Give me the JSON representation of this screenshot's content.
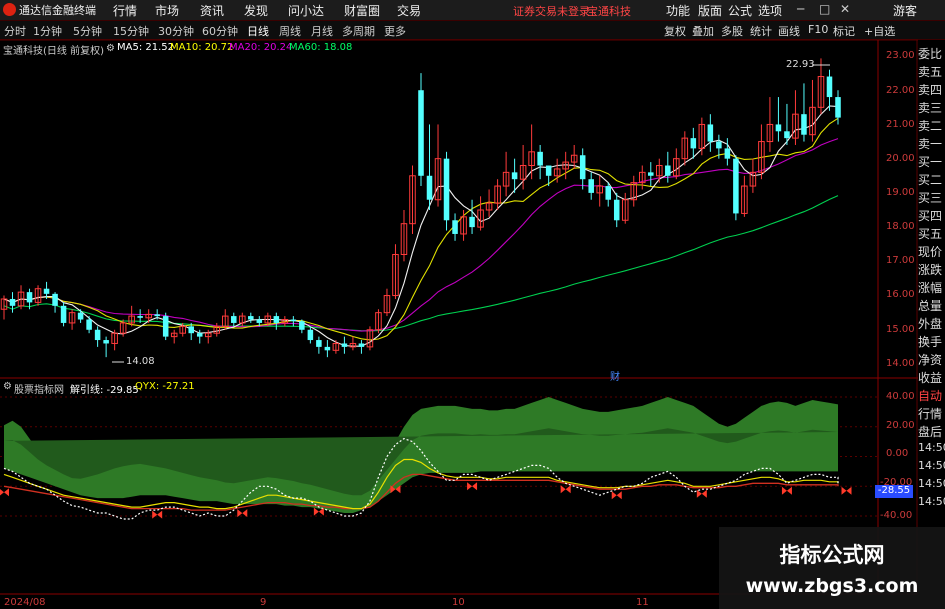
{
  "titlebar": {
    "app_name": "通达信金融终端",
    "menus": [
      "行情",
      "市场",
      "资讯",
      "发现",
      "问小达",
      "财富圈",
      "交易"
    ],
    "notice": "证券交易未登录",
    "stock_name": "宝通科技",
    "right_menus": [
      "功能",
      "版面",
      "公式",
      "选项"
    ],
    "user": "游客"
  },
  "periods": {
    "items": [
      "分时",
      "1分钟",
      "5分钟",
      "15分钟",
      "30分钟",
      "60分钟",
      "日线",
      "周线",
      "月线",
      "多周期",
      "更多"
    ],
    "selected": "日线"
  },
  "toolbar_right": [
    "复权",
    "叠加",
    "多股",
    "统计",
    "画线",
    "F10",
    "标记",
    "+自选"
  ],
  "main_chart": {
    "title": "宝通科技(日线 前复权)",
    "ma_labels": [
      {
        "text": "MA5: 21.52",
        "color": "#ffffff"
      },
      {
        "text": "MA10: 20.72",
        "color": "#ffff00"
      },
      {
        "text": "MA20: 20.24",
        "color": "#e000e0"
      },
      {
        "text": "MA60: 18.08",
        "color": "#00ff66"
      }
    ],
    "high_label": "22.93",
    "low_label": "14.08",
    "marker": "财",
    "y_ticks": [
      "23.00",
      "22.00",
      "21.00",
      "20.00",
      "19.00",
      "18.00",
      "17.00",
      "16.00",
      "15.00",
      "14.00"
    ]
  },
  "indicator": {
    "name": "股票指标网",
    "labels": [
      {
        "text": "解引线: -29.85",
        "color": "#ffffff"
      },
      {
        "text": "QYX: -27.21",
        "color": "#ffff00"
      }
    ],
    "y_ticks": [
      "40.00",
      "20.00",
      "0.00",
      "-20.00",
      "-40.00"
    ],
    "current_value": "-28.55"
  },
  "right_panel": {
    "top_tabs": [
      "委比",
      "卖五",
      "卖四",
      "卖三",
      "卖二",
      "卖一",
      "买一",
      "买二",
      "买三",
      "买四",
      "买五",
      "现价",
      "涨跌",
      "涨幅",
      "总量",
      "外盘",
      "换手",
      "净资",
      "收益"
    ],
    "bottom_tabs": [
      "自动",
      "行情",
      "盘后",
      "14:50",
      "14:50",
      "14:50",
      "14:50"
    ]
  },
  "dates": [
    "2024/08",
    "9",
    "10",
    "11"
  ],
  "watermark": {
    "line1": "指标公式网",
    "line2": "www.zbgs3.com"
  },
  "chart_data": {
    "type": "candlestick",
    "title": "宝通科技(日线 前复权)",
    "x_labels": [
      "2024/08",
      "9",
      "10",
      "11"
    ],
    "y_range": [
      13.8,
      23.2
    ],
    "candles": [
      [
        15.6,
        15.9,
        15.3,
        16.0
      ],
      [
        15.9,
        15.7,
        15.5,
        16.1
      ],
      [
        15.7,
        16.1,
        15.6,
        16.3
      ],
      [
        16.1,
        15.8,
        15.6,
        16.2
      ],
      [
        15.8,
        16.2,
        15.7,
        16.3
      ],
      [
        16.2,
        16.05,
        15.9,
        16.4
      ],
      [
        16.05,
        15.7,
        15.5,
        16.1
      ],
      [
        15.7,
        15.2,
        15.1,
        15.8
      ],
      [
        15.2,
        15.5,
        15.0,
        15.6
      ],
      [
        15.5,
        15.3,
        15.2,
        15.6
      ],
      [
        15.3,
        15.0,
        14.9,
        15.4
      ],
      [
        15.0,
        14.7,
        14.5,
        15.1
      ],
      [
        14.7,
        14.6,
        14.2,
        14.8
      ],
      [
        14.6,
        14.9,
        14.4,
        15.0
      ],
      [
        14.9,
        15.2,
        14.8,
        15.3
      ],
      [
        15.2,
        15.4,
        15.1,
        15.7
      ],
      [
        15.4,
        15.35,
        15.2,
        15.6
      ],
      [
        15.35,
        15.45,
        15.2,
        15.6
      ],
      [
        15.45,
        15.4,
        15.3,
        15.6
      ],
      [
        15.4,
        14.8,
        14.7,
        15.5
      ],
      [
        14.8,
        14.9,
        14.6,
        15.0
      ],
      [
        14.9,
        15.1,
        14.8,
        15.2
      ],
      [
        15.1,
        14.9,
        14.7,
        15.2
      ],
      [
        14.9,
        14.8,
        14.6,
        15.0
      ],
      [
        14.8,
        14.9,
        14.6,
        15.0
      ],
      [
        14.9,
        15.1,
        14.8,
        15.2
      ],
      [
        15.1,
        15.4,
        15.0,
        15.6
      ],
      [
        15.4,
        15.2,
        15.1,
        15.5
      ],
      [
        15.2,
        15.4,
        15.1,
        15.5
      ],
      [
        15.4,
        15.3,
        15.2,
        15.5
      ],
      [
        15.3,
        15.2,
        15.1,
        15.4
      ],
      [
        15.2,
        15.4,
        15.1,
        15.5
      ],
      [
        15.4,
        15.2,
        15.0,
        15.5
      ],
      [
        15.2,
        15.3,
        15.1,
        15.4
      ],
      [
        15.3,
        15.25,
        15.1,
        15.4
      ],
      [
        15.25,
        15.0,
        14.9,
        15.3
      ],
      [
        15.0,
        14.7,
        14.6,
        15.1
      ],
      [
        14.7,
        14.5,
        14.3,
        14.8
      ],
      [
        14.5,
        14.4,
        14.2,
        14.7
      ],
      [
        14.4,
        14.6,
        14.3,
        14.7
      ],
      [
        14.6,
        14.5,
        14.3,
        14.8
      ],
      [
        14.5,
        14.6,
        14.4,
        14.8
      ],
      [
        14.6,
        14.5,
        14.3,
        14.7
      ],
      [
        14.5,
        15.0,
        14.4,
        15.1
      ],
      [
        15.0,
        15.5,
        14.9,
        15.6
      ],
      [
        15.5,
        16.0,
        15.4,
        16.2
      ],
      [
        16.0,
        17.2,
        15.9,
        17.5
      ],
      [
        17.2,
        18.1,
        17.0,
        18.5
      ],
      [
        18.1,
        19.5,
        17.8,
        19.8
      ],
      [
        22.0,
        19.5,
        19.2,
        22.5
      ],
      [
        19.5,
        18.8,
        18.5,
        21.0
      ],
      [
        18.8,
        20.0,
        18.6,
        21.0
      ],
      [
        20.0,
        18.2,
        17.9,
        20.2
      ],
      [
        18.2,
        17.8,
        17.6,
        18.4
      ],
      [
        17.8,
        18.3,
        17.6,
        18.5
      ],
      [
        18.3,
        18.0,
        17.8,
        18.8
      ],
      [
        18.0,
        18.5,
        17.9,
        18.9
      ],
      [
        18.5,
        18.7,
        18.3,
        19.1
      ],
      [
        18.7,
        19.2,
        18.5,
        19.4
      ],
      [
        19.2,
        19.6,
        18.9,
        20.2
      ],
      [
        19.6,
        19.4,
        19.0,
        20.0
      ],
      [
        19.4,
        19.8,
        19.1,
        20.4
      ],
      [
        19.8,
        20.2,
        19.4,
        21.0
      ],
      [
        20.2,
        19.8,
        19.4,
        20.4
      ],
      [
        19.8,
        19.5,
        19.2,
        19.8
      ],
      [
        19.5,
        19.7,
        19.3,
        20.0
      ],
      [
        19.7,
        19.9,
        19.4,
        20.2
      ],
      [
        19.9,
        20.1,
        19.7,
        20.4
      ],
      [
        20.1,
        19.4,
        19.1,
        20.3
      ],
      [
        19.4,
        19.0,
        18.8,
        19.6
      ],
      [
        19.0,
        19.2,
        18.6,
        19.5
      ],
      [
        19.2,
        18.8,
        18.6,
        19.3
      ],
      [
        18.8,
        18.2,
        18.0,
        19.0
      ],
      [
        18.2,
        18.8,
        18.1,
        19.0
      ],
      [
        18.8,
        19.3,
        18.6,
        19.5
      ],
      [
        19.3,
        19.6,
        19.1,
        19.8
      ],
      [
        19.6,
        19.5,
        19.2,
        19.9
      ],
      [
        19.5,
        19.8,
        19.3,
        20.0
      ],
      [
        19.8,
        19.5,
        19.3,
        20.2
      ],
      [
        19.5,
        20.0,
        19.4,
        20.3
      ],
      [
        20.0,
        20.6,
        19.8,
        20.8
      ],
      [
        20.6,
        20.3,
        20.0,
        20.9
      ],
      [
        20.3,
        21.0,
        20.1,
        21.2
      ],
      [
        21.0,
        20.5,
        20.2,
        21.3
      ],
      [
        20.5,
        20.3,
        20.0,
        20.7
      ],
      [
        20.3,
        20.0,
        19.8,
        20.6
      ],
      [
        20.0,
        18.4,
        18.2,
        20.1
      ],
      [
        18.4,
        19.2,
        18.3,
        19.5
      ],
      [
        19.2,
        19.6,
        19.0,
        20.0
      ],
      [
        19.6,
        20.5,
        19.4,
        21.0
      ],
      [
        20.5,
        21.0,
        20.2,
        21.8
      ],
      [
        21.0,
        20.8,
        20.5,
        21.8
      ],
      [
        20.8,
        20.6,
        20.4,
        21.6
      ],
      [
        20.6,
        21.3,
        20.4,
        22.0
      ],
      [
        21.3,
        20.7,
        20.5,
        22.2
      ],
      [
        20.7,
        21.5,
        20.5,
        22.3
      ],
      [
        21.5,
        22.4,
        21.3,
        22.93
      ],
      [
        22.4,
        21.8,
        21.4,
        22.6
      ],
      [
        21.8,
        21.2,
        21.0,
        22.0
      ]
    ],
    "ma": {
      "MA5": 21.52,
      "MA10": 20.72,
      "MA20": 20.24,
      "MA60": 18.08
    },
    "indicator_series": {
      "name": "股票指标网",
      "y_range": [
        -46,
        46
      ],
      "band_upper": [
        21,
        24,
        20,
        12,
        4,
        -2,
        -6,
        -10,
        -13,
        -12,
        -8,
        -4,
        0,
        4,
        7,
        8,
        8,
        6,
        4,
        2,
        0,
        -2,
        -4,
        -6,
        -8,
        -10,
        -12,
        -12,
        -10,
        -8,
        -6,
        -4,
        -5,
        -6,
        -8,
        -10,
        -12,
        -14,
        -16,
        -18,
        -20,
        -22,
        -24,
        -20,
        -10,
        0,
        10,
        20,
        28,
        32,
        33,
        34,
        34,
        34,
        33,
        32,
        32,
        31,
        31,
        32,
        32,
        34,
        36,
        38,
        40,
        38,
        36,
        34,
        32,
        31,
        30,
        30,
        31,
        32,
        33,
        34,
        36,
        38,
        40,
        38,
        36,
        34,
        30,
        26,
        22,
        20,
        22,
        26,
        30,
        34,
        36,
        37,
        36,
        34,
        36,
        38,
        37,
        36,
        35,
        34,
        35,
        36
      ],
      "band_lower": [
        -8,
        -10,
        -12,
        -14,
        -16,
        -18,
        -20,
        -22,
        -24,
        -26,
        -27,
        -28,
        -28,
        -28,
        -28,
        -27,
        -26,
        -26,
        -26,
        -26,
        -27,
        -28,
        -29,
        -30,
        -30,
        -30,
        -31,
        -32,
        -32,
        -32,
        -32,
        -32,
        -32,
        -33,
        -33,
        -34,
        -34,
        -35,
        -36,
        -37,
        -38,
        -38,
        -36,
        -34,
        -30,
        -26,
        -22,
        -18,
        -14,
        -12,
        -11,
        -11,
        -11,
        -11,
        -11,
        -11,
        -10,
        -10,
        -10,
        -10,
        -10,
        -10,
        -10,
        -10,
        -10,
        -10,
        -10,
        -10,
        -10,
        -10,
        -10,
        -10,
        -10,
        -10,
        -10,
        -10,
        -10,
        -10,
        -10,
        -10,
        -10,
        -10,
        -10,
        -10,
        -10,
        -10,
        -10,
        -10,
        -10,
        -10,
        -10,
        -10,
        -10,
        -10,
        -10,
        -10,
        -10,
        -10,
        -10,
        -10,
        -10
      ],
      "line_white": [
        -8,
        -10,
        -14,
        -18,
        -20,
        -22,
        -26,
        -30,
        -33,
        -34,
        -36,
        -38,
        -38,
        -40,
        -42,
        -42,
        -38,
        -36,
        -36,
        -34,
        -34,
        -36,
        -38,
        -40,
        -38,
        -40,
        -40,
        -36,
        -30,
        -24,
        -20,
        -20,
        -22,
        -26,
        -28,
        -28,
        -30,
        -34,
        -36,
        -38,
        -40,
        -40,
        -38,
        -30,
        -14,
        0,
        8,
        12,
        10,
        4,
        -4,
        -10,
        -16,
        -16,
        -12,
        -12,
        -14,
        -16,
        -14,
        -12,
        -10,
        -8,
        -6,
        -6,
        -8,
        -14,
        -18,
        -20,
        -22,
        -24,
        -26,
        -24,
        -22,
        -20,
        -20,
        -18,
        -14,
        -12,
        -10,
        -14,
        -20,
        -24,
        -22,
        -22,
        -20,
        -18,
        -16,
        -12,
        -10,
        -8,
        -8,
        -12,
        -18,
        -16,
        -14,
        -12,
        -12,
        -14,
        -14,
        -16,
        -18
      ],
      "line_yellow": [
        -12,
        -14,
        -16,
        -18,
        -20,
        -22,
        -24,
        -26,
        -27,
        -28,
        -29,
        -30,
        -31,
        -32,
        -33,
        -34,
        -34,
        -33,
        -32,
        -31,
        -31,
        -32,
        -33,
        -34,
        -34,
        -35,
        -35,
        -34,
        -32,
        -30,
        -28,
        -26,
        -26,
        -27,
        -28,
        -29,
        -30,
        -31,
        -32,
        -33,
        -34,
        -35,
        -35,
        -32,
        -24,
        -14,
        -6,
        -2,
        -2,
        -4,
        -8,
        -11,
        -13,
        -14,
        -14,
        -14,
        -14,
        -15,
        -15,
        -14,
        -14,
        -14,
        -14,
        -14,
        -14,
        -16,
        -17,
        -18,
        -19,
        -20,
        -21,
        -21,
        -21,
        -20,
        -20,
        -19,
        -18,
        -17,
        -16,
        -17,
        -18,
        -20,
        -20,
        -20,
        -19,
        -18,
        -17,
        -16,
        -15,
        -14,
        -14,
        -15,
        -17,
        -17,
        -16,
        -16,
        -16,
        -17,
        -17,
        -17,
        -18
      ],
      "line_red": [
        -20,
        -21,
        -22,
        -23,
        -24,
        -25,
        -26,
        -27,
        -28,
        -29,
        -30,
        -31,
        -32,
        -33,
        -34,
        -35,
        -35,
        -35,
        -35,
        -35,
        -35,
        -35,
        -36,
        -36,
        -36,
        -36,
        -36,
        -35,
        -34,
        -33,
        -32,
        -31,
        -31,
        -31,
        -32,
        -32,
        -33,
        -33,
        -34,
        -34,
        -35,
        -35,
        -35,
        -34,
        -30,
        -24,
        -18,
        -14,
        -12,
        -12,
        -13,
        -14,
        -15,
        -16,
        -16,
        -16,
        -16,
        -16,
        -16,
        -16,
        -16,
        -16,
        -16,
        -16,
        -16,
        -17,
        -18,
        -19,
        -20,
        -21,
        -22,
        -22,
        -22,
        -22,
        -21,
        -20,
        -20,
        -19,
        -19,
        -19,
        -20,
        -21,
        -21,
        -21,
        -21,
        -20,
        -20,
        -19,
        -18,
        -18,
        -18,
        -18,
        -19,
        -19,
        -19,
        -19,
        -19,
        -19,
        -19,
        -19,
        -20
      ],
      "markers_idx": [
        0,
        18,
        28,
        37,
        46,
        55,
        66,
        72,
        82,
        92,
        99
      ]
    }
  }
}
